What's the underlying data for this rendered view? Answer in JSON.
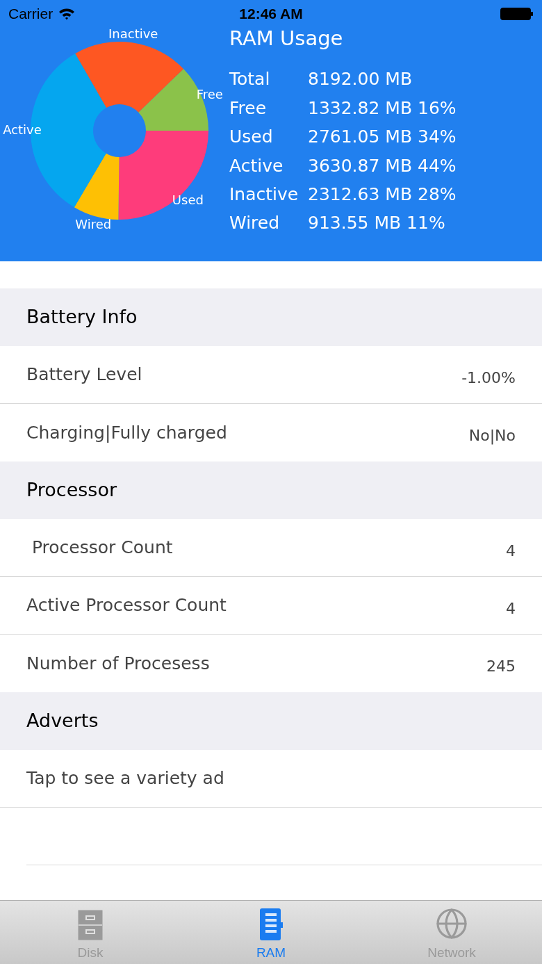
{
  "status_bar": {
    "carrier": "Carrier",
    "time": "12:46 AM"
  },
  "ram": {
    "title": "RAM Usage",
    "chart_data": {
      "type": "donut",
      "categories": [
        "Used",
        "Wired",
        "Active",
        "Inactive",
        "Free"
      ],
      "values": [
        25.2,
        8.3,
        33.2,
        21.1,
        12.2
      ],
      "colors": [
        "#fe3c7b",
        "#fec004",
        "#05a6ef",
        "#fe5722",
        "#8bc24a"
      ]
    },
    "stats": [
      {
        "label": "Total",
        "value": "8192.00 MB"
      },
      {
        "label": "Free",
        "value": "1332.82 MB 16%"
      },
      {
        "label": "Used",
        "value": "2761.05 MB 34%"
      },
      {
        "label": "Active",
        "value": "3630.87 MB 44%"
      },
      {
        "label": "Inactive",
        "value": "2312.63 MB 28%"
      },
      {
        "label": "Wired",
        "value": "913.55 MB 11%"
      }
    ]
  },
  "sections": [
    {
      "title": "Battery Info",
      "rows": [
        {
          "label": "Battery Level",
          "value": "-1.00%"
        },
        {
          "label": "Charging|Fully charged",
          "value": "No|No"
        }
      ]
    },
    {
      "title": "Processor",
      "rows": [
        {
          "label": " Processor Count",
          "value": "4"
        },
        {
          "label": "Active Processor Count",
          "value": "4"
        },
        {
          "label": "Number of Procesess",
          "value": "245"
        }
      ]
    },
    {
      "title": "Adverts",
      "rows": [
        {
          "label": "Tap to see a variety ad"
        }
      ]
    }
  ],
  "tab_bar": [
    {
      "label": "Disk",
      "kind": "disk",
      "selected": false
    },
    {
      "label": "RAM",
      "kind": "ram",
      "selected": true
    },
    {
      "label": "Network",
      "kind": "network",
      "selected": false
    }
  ]
}
